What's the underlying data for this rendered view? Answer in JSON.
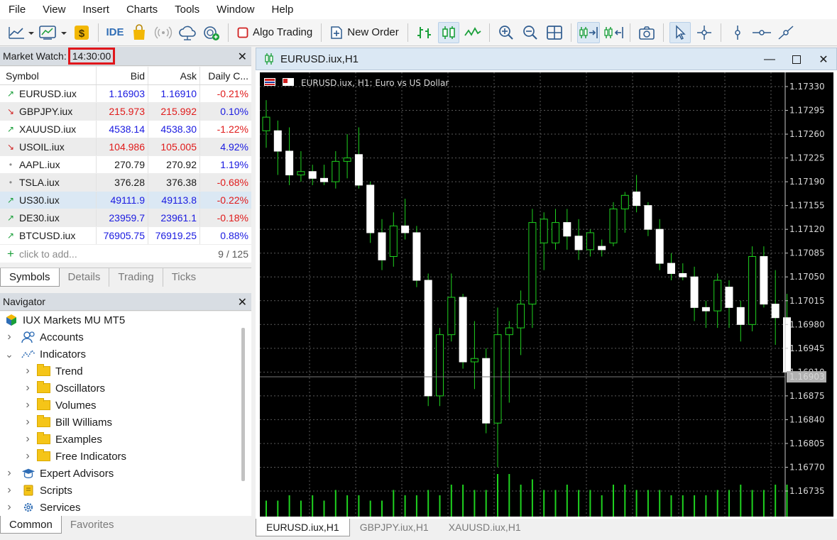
{
  "menu": [
    "File",
    "View",
    "Insert",
    "Charts",
    "Tools",
    "Window",
    "Help"
  ],
  "toolbar": {
    "ide_label": "IDE",
    "algo_trading_label": "Algo Trading",
    "new_order_label": "New Order",
    "icons": [
      "new-chart-icon",
      "chart-templates-icon",
      "market-icon",
      "ide-icon",
      "market-bag-icon",
      "signals-icon",
      "vps-icon",
      "trading-community-icon",
      "algo-trading-icon",
      "new-order-icon",
      "bar-chart-icon",
      "candlestick-icon",
      "line-chart-icon",
      "zoom-in-icon",
      "zoom-out-icon",
      "tile-windows-icon",
      "auto-scroll-icon",
      "chart-shift-icon",
      "screenshot-icon",
      "cursor-icon",
      "crosshair-icon",
      "vertical-line-icon",
      "horizontal-line-icon",
      "trendline-icon"
    ]
  },
  "market_watch": {
    "title": "Market Watch:",
    "time": "14:30:00",
    "columns": [
      "Symbol",
      "Bid",
      "Ask",
      "Daily C..."
    ],
    "rows": [
      {
        "symbol": "EURUSD.iux",
        "bid": "1.16903",
        "ask": "1.16910",
        "change": "-0.21%",
        "dir": "up",
        "price_color": "blue",
        "change_color": "red"
      },
      {
        "symbol": "GBPJPY.iux",
        "bid": "215.973",
        "ask": "215.992",
        "change": "0.10%",
        "dir": "down",
        "price_color": "red",
        "change_color": "blue"
      },
      {
        "symbol": "XAUUSD.iux",
        "bid": "4538.14",
        "ask": "4538.30",
        "change": "-1.22%",
        "dir": "up",
        "price_color": "blue",
        "change_color": "red"
      },
      {
        "symbol": "USOIL.iux",
        "bid": "104.986",
        "ask": "105.005",
        "change": "4.92%",
        "dir": "down",
        "price_color": "red",
        "change_color": "blue"
      },
      {
        "symbol": "AAPL.iux",
        "bid": "270.79",
        "ask": "270.92",
        "change": "1.19%",
        "dir": "none",
        "price_color": "black",
        "change_color": "blue"
      },
      {
        "symbol": "TSLA.iux",
        "bid": "376.28",
        "ask": "376.38",
        "change": "-0.68%",
        "dir": "none",
        "price_color": "black",
        "change_color": "red"
      },
      {
        "symbol": "US30.iux",
        "bid": "49111.9",
        "ask": "49113.8",
        "change": "-0.22%",
        "dir": "up",
        "price_color": "blue",
        "change_color": "red"
      },
      {
        "symbol": "DE30.iux",
        "bid": "23959.7",
        "ask": "23961.1",
        "change": "-0.18%",
        "dir": "up",
        "price_color": "blue",
        "change_color": "red"
      },
      {
        "symbol": "BTCUSD.iux",
        "bid": "76905.75",
        "ask": "76919.25",
        "change": "0.88%",
        "dir": "up",
        "price_color": "blue",
        "change_color": "blue"
      }
    ],
    "add_placeholder": "click to add...",
    "count": "9 / 125",
    "tabs": [
      "Symbols",
      "Details",
      "Trading",
      "Ticks"
    ]
  },
  "navigator": {
    "title": "Navigator",
    "root": "IUX Markets MU MT5",
    "items": [
      {
        "label": "Accounts",
        "level": 1,
        "icon": "accounts-icon"
      },
      {
        "label": "Indicators",
        "level": 1,
        "icon": "indicators-icon"
      },
      {
        "label": "Trend",
        "level": 2,
        "icon": "folder-icon"
      },
      {
        "label": "Oscillators",
        "level": 2,
        "icon": "folder-icon"
      },
      {
        "label": "Volumes",
        "level": 2,
        "icon": "folder-icon"
      },
      {
        "label": "Bill Williams",
        "level": 2,
        "icon": "folder-icon"
      },
      {
        "label": "Examples",
        "level": 2,
        "icon": "folder-icon"
      },
      {
        "label": "Free Indicators",
        "level": 2,
        "icon": "folder-icon"
      },
      {
        "label": "Expert Advisors",
        "level": 1,
        "icon": "expert-advisors-icon"
      },
      {
        "label": "Scripts",
        "level": 1,
        "icon": "scripts-icon"
      },
      {
        "label": "Services",
        "level": 1,
        "icon": "services-icon"
      }
    ],
    "tabs": [
      "Common",
      "Favorites"
    ]
  },
  "chart_window": {
    "title": "EURUSD.iux,H1",
    "legend": "EURUSD.iux, H1:  Euro vs US Dollar",
    "current_price": "1.16903",
    "price_labels": [
      "1.17330",
      "1.17295",
      "1.17260",
      "1.17225",
      "1.17190",
      "1.17155",
      "1.17120",
      "1.17085",
      "1.17050",
      "1.17015",
      "1.16980",
      "1.16945",
      "1.16910",
      "1.16875",
      "1.16840",
      "1.16805",
      "1.16770",
      "1.16735"
    ],
    "tabs": [
      "EURUSD.iux,H1",
      "GBPJPY.iux,H1",
      "XAUUSD.iux,H1"
    ]
  },
  "chart_data": {
    "type": "candlestick",
    "ylim": [
      1.167,
      1.1735
    ],
    "current_price": 1.16903,
    "candles": [
      {
        "o": 1.17265,
        "h": 1.1731,
        "l": 1.1724,
        "c": 1.17285
      },
      {
        "o": 1.17265,
        "h": 1.1728,
        "l": 1.172,
        "c": 1.17235
      },
      {
        "o": 1.17235,
        "h": 1.1727,
        "l": 1.17185,
        "c": 1.172
      },
      {
        "o": 1.172,
        "h": 1.17235,
        "l": 1.1719,
        "c": 1.17205
      },
      {
        "o": 1.17205,
        "h": 1.17215,
        "l": 1.17185,
        "c": 1.17195
      },
      {
        "o": 1.17195,
        "h": 1.17215,
        "l": 1.17185,
        "c": 1.1719
      },
      {
        "o": 1.1719,
        "h": 1.17235,
        "l": 1.1718,
        "c": 1.1722
      },
      {
        "o": 1.1722,
        "h": 1.1726,
        "l": 1.17195,
        "c": 1.17225
      },
      {
        "o": 1.1723,
        "h": 1.1727,
        "l": 1.1718,
        "c": 1.17185
      },
      {
        "o": 1.17185,
        "h": 1.1719,
        "l": 1.171,
        "c": 1.17115
      },
      {
        "o": 1.17115,
        "h": 1.17135,
        "l": 1.1706,
        "c": 1.17075
      },
      {
        "o": 1.1708,
        "h": 1.17145,
        "l": 1.17065,
        "c": 1.17125
      },
      {
        "o": 1.17125,
        "h": 1.17165,
        "l": 1.17105,
        "c": 1.17115
      },
      {
        "o": 1.17115,
        "h": 1.17125,
        "l": 1.17035,
        "c": 1.17045
      },
      {
        "o": 1.17045,
        "h": 1.17055,
        "l": 1.1686,
        "c": 1.16875
      },
      {
        "o": 1.16875,
        "h": 1.16975,
        "l": 1.1686,
        "c": 1.16965
      },
      {
        "o": 1.16965,
        "h": 1.17055,
        "l": 1.16955,
        "c": 1.1702
      },
      {
        "o": 1.1702,
        "h": 1.17025,
        "l": 1.16915,
        "c": 1.16925
      },
      {
        "o": 1.16925,
        "h": 1.16985,
        "l": 1.16885,
        "c": 1.1693
      },
      {
        "o": 1.1693,
        "h": 1.16945,
        "l": 1.1682,
        "c": 1.16835
      },
      {
        "o": 1.16835,
        "h": 1.17005,
        "l": 1.1677,
        "c": 1.16965
      },
      {
        "o": 1.16965,
        "h": 1.16985,
        "l": 1.16865,
        "c": 1.16975
      },
      {
        "o": 1.16975,
        "h": 1.1703,
        "l": 1.16935,
        "c": 1.1701
      },
      {
        "o": 1.1701,
        "h": 1.1715,
        "l": 1.16975,
        "c": 1.1713
      },
      {
        "o": 1.171,
        "h": 1.17145,
        "l": 1.1706,
        "c": 1.17135
      },
      {
        "o": 1.171,
        "h": 1.1715,
        "l": 1.1709,
        "c": 1.1713
      },
      {
        "o": 1.1713,
        "h": 1.1715,
        "l": 1.1709,
        "c": 1.1711
      },
      {
        "o": 1.1711,
        "h": 1.17135,
        "l": 1.17075,
        "c": 1.1709
      },
      {
        "o": 1.1709,
        "h": 1.1712,
        "l": 1.1708,
        "c": 1.17115
      },
      {
        "o": 1.17095,
        "h": 1.17105,
        "l": 1.1708,
        "c": 1.1709
      },
      {
        "o": 1.171,
        "h": 1.1716,
        "l": 1.17095,
        "c": 1.1715
      },
      {
        "o": 1.1715,
        "h": 1.17175,
        "l": 1.17115,
        "c": 1.1717
      },
      {
        "o": 1.17175,
        "h": 1.172,
        "l": 1.17145,
        "c": 1.17155
      },
      {
        "o": 1.17155,
        "h": 1.1716,
        "l": 1.1711,
        "c": 1.1712
      },
      {
        "o": 1.1712,
        "h": 1.17135,
        "l": 1.1706,
        "c": 1.1707
      },
      {
        "o": 1.1707,
        "h": 1.17085,
        "l": 1.17045,
        "c": 1.17055
      },
      {
        "o": 1.17055,
        "h": 1.1707,
        "l": 1.17045,
        "c": 1.1705
      },
      {
        "o": 1.1705,
        "h": 1.17065,
        "l": 1.16985,
        "c": 1.17005
      },
      {
        "o": 1.17005,
        "h": 1.17015,
        "l": 1.16975,
        "c": 1.17
      },
      {
        "o": 1.17,
        "h": 1.17055,
        "l": 1.16975,
        "c": 1.17045
      },
      {
        "o": 1.17035,
        "h": 1.17045,
        "l": 1.16975,
        "c": 1.17005
      },
      {
        "o": 1.17005,
        "h": 1.17015,
        "l": 1.16955,
        "c": 1.1698
      },
      {
        "o": 1.1698,
        "h": 1.17095,
        "l": 1.1697,
        "c": 1.1708
      },
      {
        "o": 1.1708,
        "h": 1.17095,
        "l": 1.17005,
        "c": 1.1701
      },
      {
        "o": 1.1701,
        "h": 1.1706,
        "l": 1.1695,
        "c": 1.1699
      },
      {
        "o": 1.1699,
        "h": 1.17025,
        "l": 1.169,
        "c": 1.1691
      }
    ],
    "volumes": [
      3,
      3,
      4,
      3,
      4,
      3,
      5,
      4,
      4,
      3,
      3,
      5,
      4,
      4,
      5,
      4,
      6,
      6,
      5,
      5,
      8,
      8,
      6,
      7,
      5,
      5,
      6,
      5,
      5,
      4,
      6,
      6,
      5,
      5,
      5,
      4,
      4,
      4,
      4,
      5,
      5,
      6,
      5,
      5,
      6,
      6
    ]
  }
}
